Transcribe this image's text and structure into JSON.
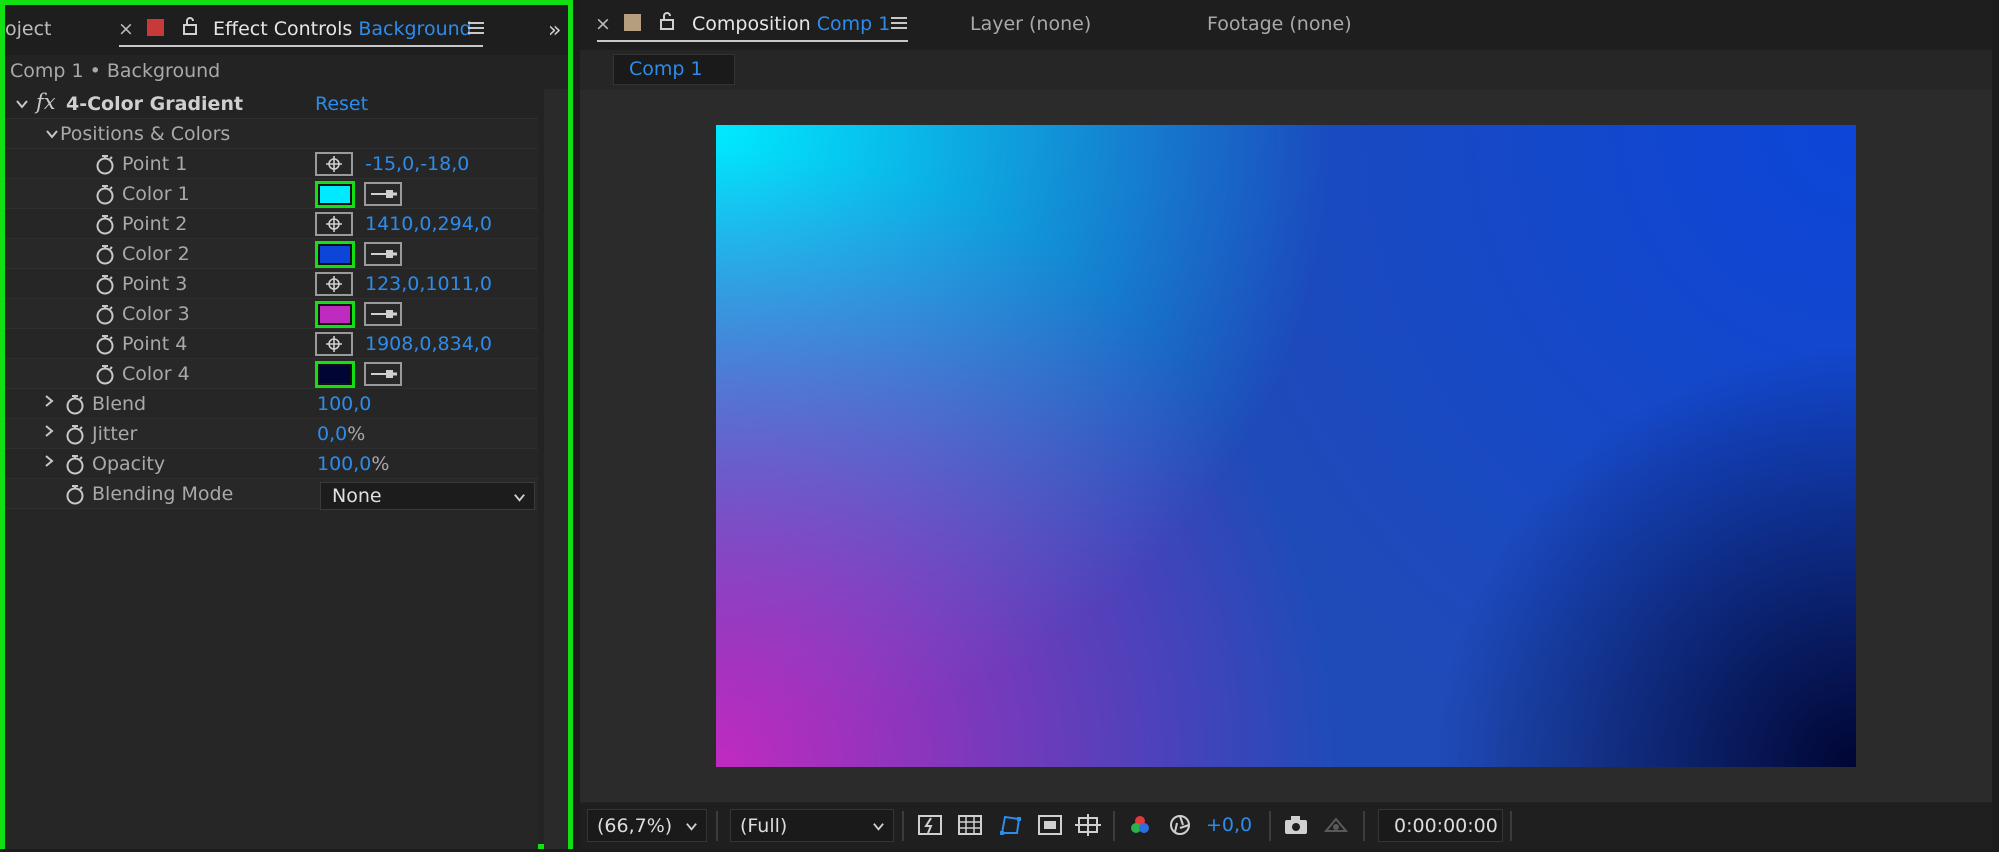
{
  "left_panel": {
    "project_tab": "oject",
    "effect_tab": {
      "title": "Effect Controls",
      "layer": "Background",
      "label_color": "#c8393b"
    },
    "layer_path": "Comp 1 • Background",
    "effect": {
      "fx_label": "fx",
      "name": "4-Color Gradient",
      "reset": "Reset",
      "group": "Positions & Colors",
      "rows": [
        {
          "kind": "point",
          "label": "Point 1",
          "value": "-15,0,-18,0"
        },
        {
          "kind": "color",
          "label": "Color 1",
          "color": "#00eaff"
        },
        {
          "kind": "point",
          "label": "Point 2",
          "value": "1410,0,294,0"
        },
        {
          "kind": "color",
          "label": "Color 2",
          "color": "#0c45d8"
        },
        {
          "kind": "point",
          "label": "Point 3",
          "value": "123,0,1011,0"
        },
        {
          "kind": "color",
          "label": "Color 3",
          "color": "#c02bbf"
        },
        {
          "kind": "point",
          "label": "Point 4",
          "value": "1908,0,834,0"
        },
        {
          "kind": "color",
          "label": "Color 4",
          "color": "#000533"
        }
      ],
      "blend": {
        "label": "Blend",
        "value": "100,0"
      },
      "jitter": {
        "label": "Jitter",
        "value": "0,0",
        "unit": "%"
      },
      "opacity": {
        "label": "Opacity",
        "value": "100,0",
        "unit": "%"
      },
      "blending_mode": {
        "label": "Blending Mode",
        "value": "None"
      }
    }
  },
  "right_panel": {
    "composition_tab": {
      "title": "Composition",
      "name": "Comp 1",
      "label_color": "#b49e7d"
    },
    "layer_tab": "Layer (none)",
    "footage_tab": "Footage (none)",
    "comp_subtab": "Comp 1",
    "bottom_bar": {
      "zoom": "(66,7%)",
      "resolution": "(Full)",
      "exposure": "+0,0",
      "timecode": "0:00:00:00"
    }
  },
  "colors": {
    "accent": "#2d8ceb",
    "highlight": "#12e012",
    "panel_bg": "#232323"
  }
}
